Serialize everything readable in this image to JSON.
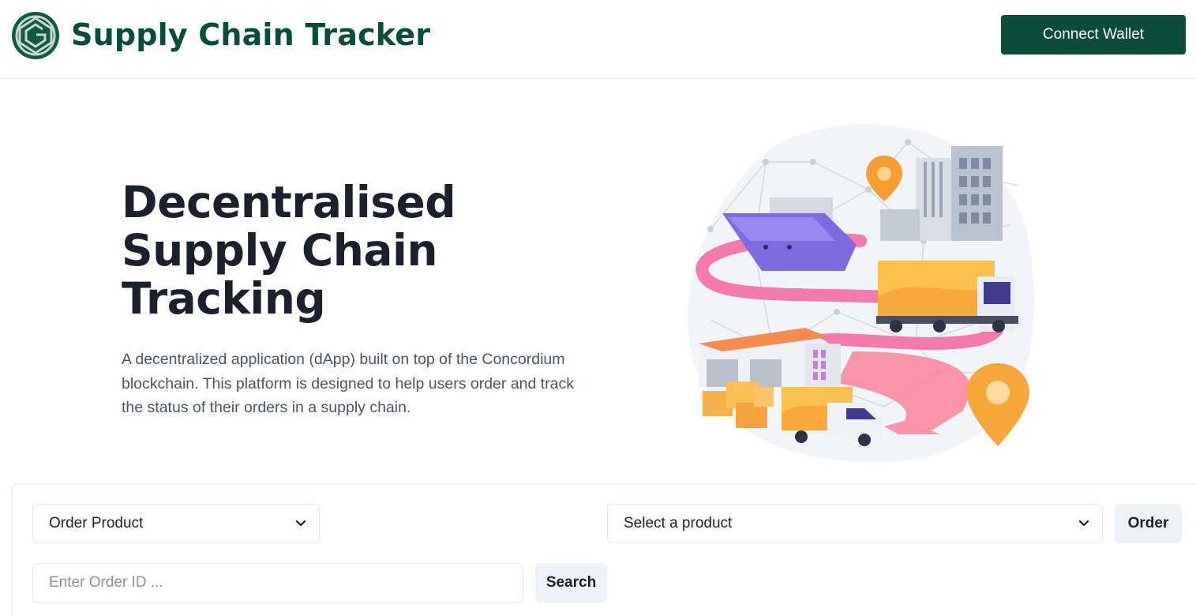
{
  "header": {
    "title": "Supply Chain Tracker",
    "connect_label": "Connect Wallet",
    "logo_icon": "concordium-logo-icon"
  },
  "hero": {
    "title_lines": [
      "Decentralised",
      "Supply Chain",
      "Tracking"
    ],
    "description": "A decentralized application (dApp) built on top of the Concordium blockchain. This platform is designed to help users order and track the status of their orders in a supply chain.",
    "illustration": "supply-chain-illustration"
  },
  "form": {
    "action_select": {
      "value": "Order Product"
    },
    "product_select": {
      "value": "Select a product"
    },
    "order_label": "Order",
    "order_id_placeholder": "Enter Order ID ...",
    "search_label": "Search"
  },
  "colors": {
    "brand": "#064e3b",
    "button_primary": "#0b4d3a",
    "button_light": "#edf2f7"
  }
}
